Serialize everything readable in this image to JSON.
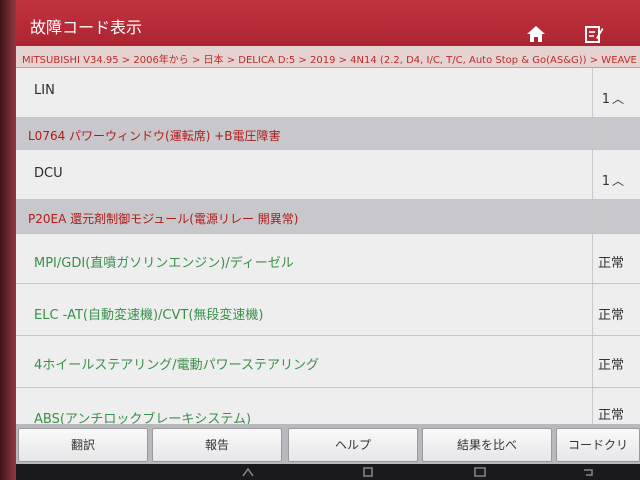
{
  "header": {
    "title": "故障コード表示",
    "home_icon": "home-icon",
    "report_icon": "report-icon"
  },
  "breadcrumb": "MITSUBISHI V34.95 > 2006年から > 日本 > DELICA D:5 > 2019 > 4N14 (2.2, D4, I/C, T/C, Auto Stop & Go(AS&G)) > WEAVE",
  "rows": [
    {
      "type": "module",
      "name": "LIN",
      "status": "1"
    },
    {
      "type": "fault",
      "name": "L0764 パワーウィンドウ(運転席) +B電圧障害"
    },
    {
      "type": "module",
      "name": "DCU",
      "status": "1"
    },
    {
      "type": "fault",
      "name": "P20EA 還元剤制御モジュール(電源リレー 開異常)"
    },
    {
      "type": "system",
      "name": "MPI/GDI(直噴ガソリンエンジン)/ディーゼル",
      "status": "正常"
    },
    {
      "type": "system",
      "name": "ELC -AT(自動変速機)/CVT(無段変速機)",
      "status": "正常"
    },
    {
      "type": "system",
      "name": "4ホイールステアリング/電動パワーステアリング",
      "status": "正常"
    },
    {
      "type": "system",
      "name": "ABS(アンチロックブレーキシステム)",
      "status": "正常"
    }
  ],
  "toolbar": {
    "translate": "翻訳",
    "report": "報告",
    "help": "ヘルプ",
    "compare": "結果を比べ",
    "clear": "コードクリ"
  },
  "colors": {
    "titlebar": "#b72a36",
    "fault_text": "#b01a1a",
    "system_text": "#3a8f4a"
  }
}
